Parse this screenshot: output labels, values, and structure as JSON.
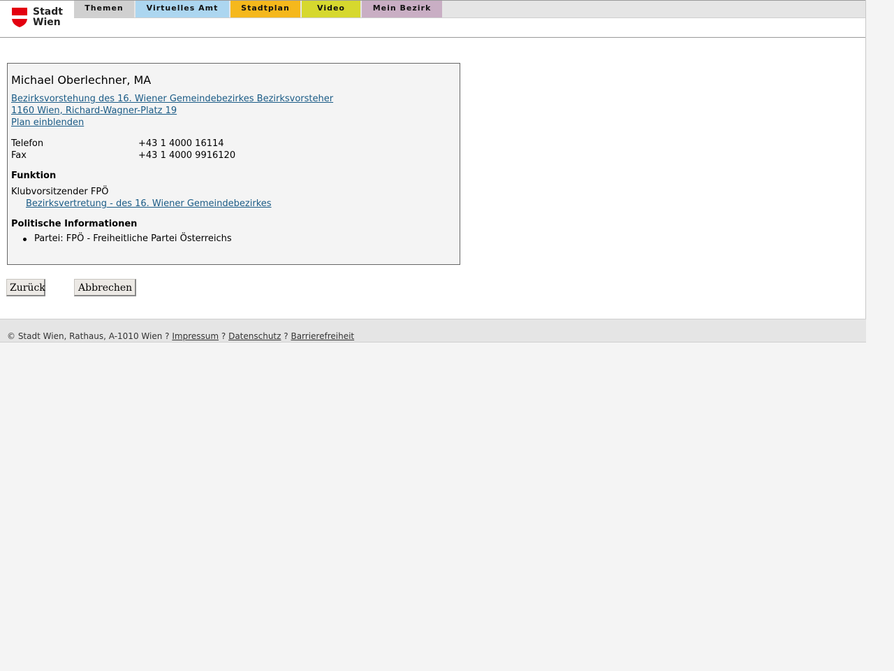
{
  "header": {
    "logo": {
      "icon": "vienna-coat-of-arms-icon",
      "line1": "Stadt",
      "line2": "Wien",
      "brand_color": "#e3000f"
    },
    "tabs": [
      {
        "label": "Themen",
        "color": "#d0d0d0"
      },
      {
        "label": "Virtuelles Amt",
        "color": "#acd6f0"
      },
      {
        "label": "Stadtplan",
        "color": "#f5b81c"
      },
      {
        "label": "Video",
        "color": "#d6d82e"
      },
      {
        "label": "Mein Bezirk",
        "color": "#c9aec4"
      }
    ]
  },
  "person": {
    "name": "Michael Oberlechner, MA",
    "office_link": "Bezirksvorstehung des 16. Wiener Gemeindebezirkes Bezirksvorsteher",
    "address_link": "1160 Wien, Richard-Wagner-Platz 19",
    "map_link": "Plan einblenden",
    "contacts": [
      {
        "label": "Telefon",
        "value": "+43 1 4000 16114"
      },
      {
        "label": "Fax",
        "value": "+43 1 4000 9916120"
      }
    ],
    "function_heading": "Funktion",
    "function_title": "Klubvorsitzender FPÖ",
    "function_link": "Bezirksvertretung - des 16. Wiener Gemeindebezirkes",
    "politics_heading": "Politische Informationen",
    "politics_items": [
      "Partei: FPÖ - Freiheitliche Partei Österreichs"
    ]
  },
  "buttons": {
    "back": "Zurück",
    "cancel": "Abbrechen"
  },
  "footer": {
    "copyright": "© Stadt Wien, Rathaus, A-1010 Wien",
    "sep1": "?",
    "impressum": "Impressum",
    "sep2": "?",
    "datenschutz": "Datenschutz",
    "sep3": "?",
    "barrierefreiheit": "Barrierefreiheit"
  },
  "colors": {
    "link": "#1a5b86",
    "card_bg": "#f4f4f4",
    "page_bg": "#f4f4f4"
  }
}
